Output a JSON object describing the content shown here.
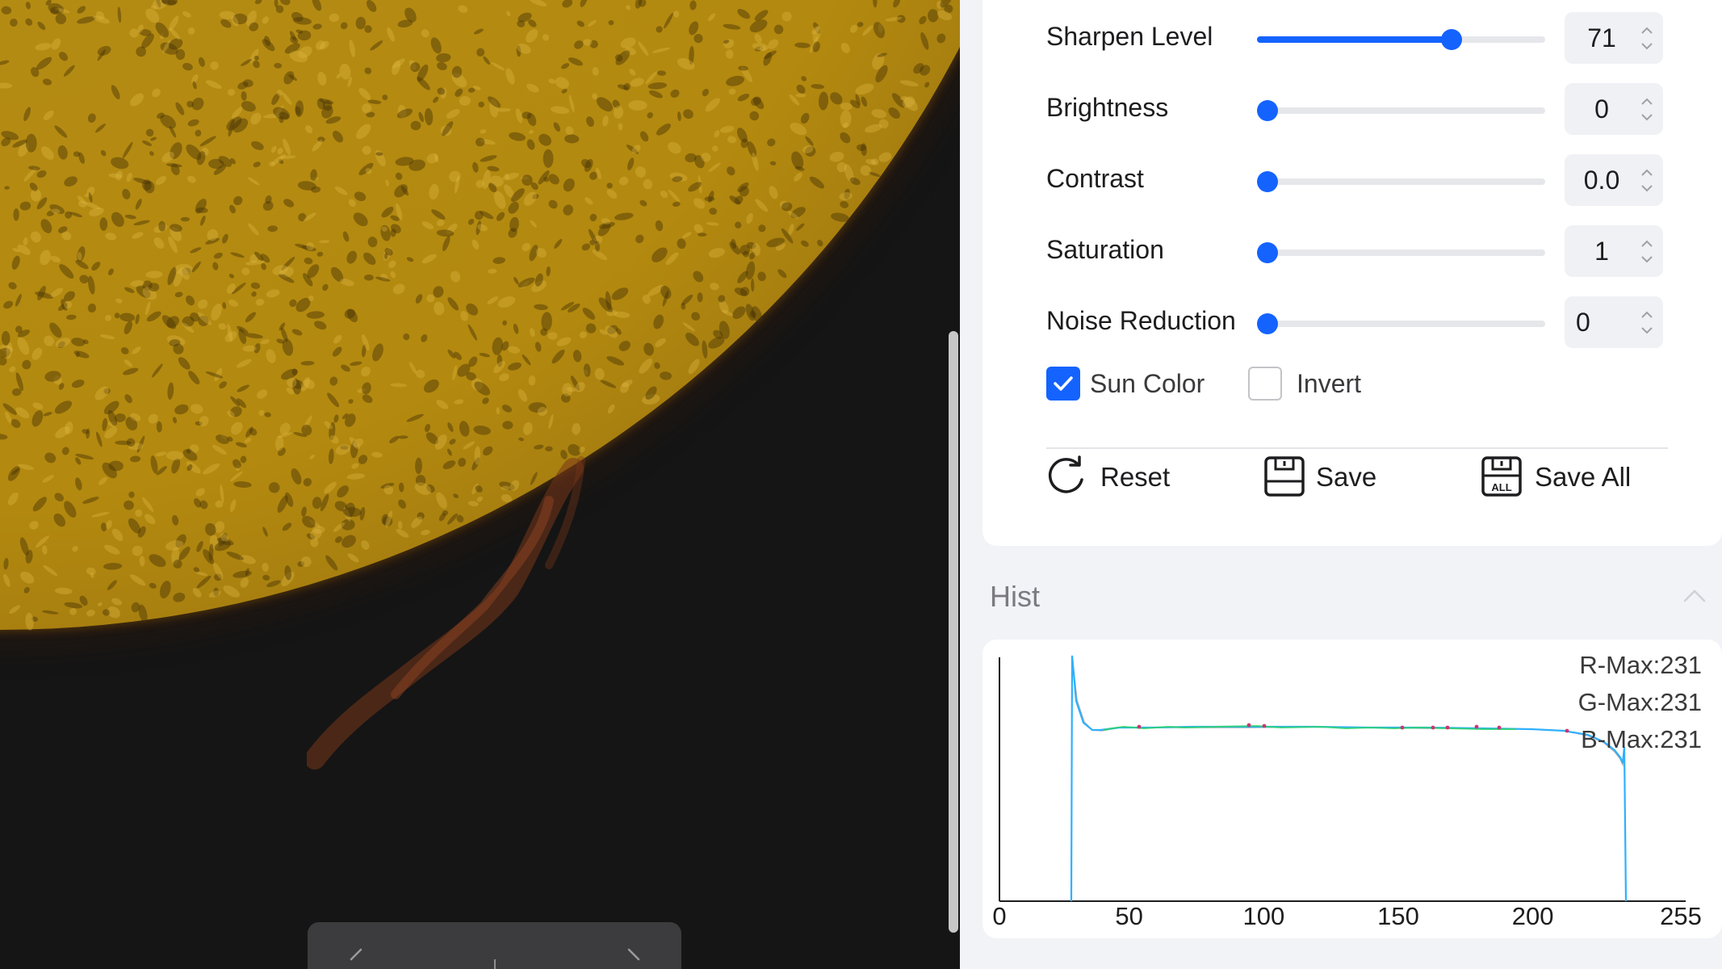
{
  "viewer": {
    "nav_prev_icon": "chevron-left-icon",
    "nav_next_icon": "chevron-right-icon"
  },
  "settings": {
    "sliders": [
      {
        "label": "Sharpen Level",
        "value": "71",
        "fraction": 0.69
      },
      {
        "label": "Brightness",
        "value": "0",
        "fraction": 0.0
      },
      {
        "label": "Contrast",
        "value": "0.0",
        "fraction": 0.0
      },
      {
        "label": "Saturation",
        "value": "1",
        "fraction": 0.0
      },
      {
        "label": "Noise Reduction",
        "value": "0",
        "fraction": 0.0
      }
    ],
    "sun_color": {
      "label": "Sun Color",
      "checked": true
    },
    "invert": {
      "label": "Invert",
      "checked": false
    },
    "actions": {
      "reset": "Reset",
      "save": "Save",
      "save_all": "Save All",
      "save_all_icon_text": "ALL"
    },
    "accent_color": "#1463ff"
  },
  "hist": {
    "title": "Hist",
    "r_max": "R-Max:231",
    "g_max": "G-Max:231",
    "b_max": "B-Max:231",
    "x_ticks": [
      "0",
      "50",
      "100",
      "150",
      "200",
      "255"
    ],
    "x_tick_values": [
      0,
      50,
      100,
      150,
      200,
      255
    ]
  }
}
